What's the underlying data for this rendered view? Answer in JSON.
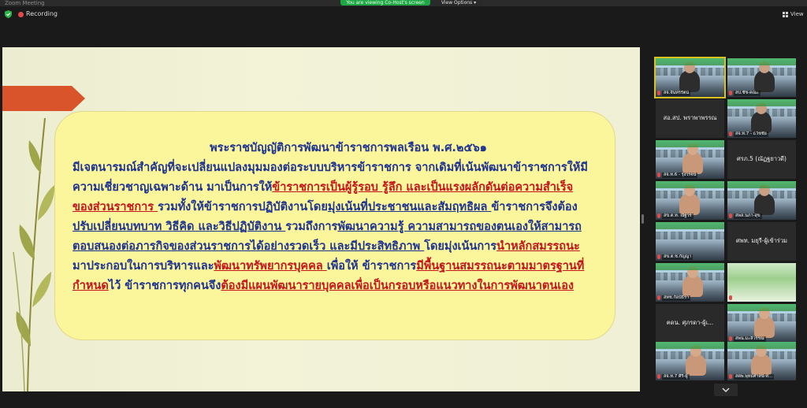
{
  "window": {
    "title": "Zoom Meeting",
    "share_banner": "You are viewing Co-Host's screen",
    "view_options": "View Options ▾"
  },
  "toolbar": {
    "recording_label": "Recording",
    "view_label": "View"
  },
  "slide": {
    "title": "พระราชบัญญัติการพัฒนาข้าราชการพลเรือน พ.ศ.๒๕๖๑",
    "lines": [
      [
        {
          "t": "มีเจตนารมณ์สำคัญที่จะเปลี่ยนแปลงมุมมองต่อระบบบริหารข้าราชการ จากเดิมที่เน้นพัฒนาข้าราชการให้มี",
          "s": "n"
        }
      ],
      [
        {
          "t": "ความเชี่ยวชาญเฉพาะด้าน มาเป็นการให้",
          "s": "n"
        },
        {
          "t": "ข้าราชการเป็นผู้รู้รอบ รู้ลึก และเป็นแรงผลักดันต่อความสำเร็จ",
          "s": "r"
        }
      ],
      [
        {
          "t": "ของส่วนราชการ ",
          "s": "r"
        },
        {
          "t": " รวมทั้งให้ข้าราชการปฏิบัติงานโดย",
          "s": "n"
        },
        {
          "t": "มุ่งเน้นที่ประชาชนและสัมฤทธิผล ",
          "s": "u"
        },
        {
          "t": " ข้าราชการจึงต้อง",
          "s": "n"
        }
      ],
      [
        {
          "t": "ปรับเปลี่ยนบทบาท วิธีคิด และวิธีปฏิบัติงาน ",
          "s": "u"
        },
        {
          "t": " รวมถึงการ",
          "s": "n"
        },
        {
          "t": "พัฒนาความรู้ ความสามารถของตนเองให้สามารถ",
          "s": "u"
        }
      ],
      [
        {
          "t": "ตอบสนองต่อภารกิจของส่วนราชการได้อย่างรวดเร็ว และมีประสิทธิภาพ ",
          "s": "u"
        },
        {
          "t": " โดยมุ่งเน้นการ",
          "s": "n"
        },
        {
          "t": "นำหลักสมรรถนะ",
          "s": "r"
        }
      ],
      [
        {
          "t": "มาประกอบในการบริหารและ",
          "s": "n"
        },
        {
          "t": "พัฒนาทรัพยากรบุคคล ",
          "s": "r"
        },
        {
          "t": " เพื่อให้ ข้าราชการ",
          "s": "n"
        },
        {
          "t": "มีพื้นฐานสมรรถนะตามมาตรฐานที่",
          "s": "r"
        }
      ],
      [
        {
          "t": "กำหนด",
          "s": "r"
        },
        {
          "t": "ไว้ ข้าราชการทุกคนจึง",
          "s": "n"
        },
        {
          "t": "ต้องมีแผนพัฒนารายบุคคลเพื่อเป็นกรอบหรือแนวทางในการพัฒนาตนเอง",
          "s": "r"
        }
      ]
    ]
  },
  "gallery": {
    "tiles": [
      {
        "kind": "video",
        "name": "สจ.จันทรรัตน์",
        "active": true,
        "person": "dark"
      },
      {
        "kind": "video",
        "name": "สป.ชัช-คณะ",
        "active": false,
        "person": "dark"
      },
      {
        "kind": "name",
        "name": "สอ.สป. พราพาพรรณ"
      },
      {
        "kind": "video",
        "name": "สจ.ท.7 - ธวัชชัย",
        "active": false,
        "person": "dark"
      },
      {
        "kind": "video",
        "name": "สจ.ท.6 - รุ่งโรจน์",
        "active": false,
        "person": "light"
      },
      {
        "kind": "name",
        "name": "ศรภ.5 (ณัฏฐยาวดี)"
      },
      {
        "kind": "video",
        "name": "สข.ต.ท. ณัฐวร",
        "active": false,
        "person": "light"
      },
      {
        "kind": "video",
        "name": "สพล.นภา-สุข",
        "active": false,
        "person": "dark"
      },
      {
        "kind": "video",
        "name": "สข.ต.ช.กัญญา",
        "active": false,
        "person": "none"
      },
      {
        "kind": "name",
        "name": "ศพท. มยุรี-ผู้เข้าร่วม"
      },
      {
        "kind": "video",
        "name": "สทช.กัลป์ธิรา",
        "active": false,
        "person": "light"
      },
      {
        "kind": "green",
        "name": "",
        "active": false,
        "person": "none"
      },
      {
        "kind": "name",
        "name": "ฅดน. ศุภรดา-ผู้เ..."
      },
      {
        "kind": "video",
        "name": "สพน.มะลิวรรณ",
        "active": false,
        "person": "light"
      },
      {
        "kind": "video",
        "name": "สจ.ท.7 ศิริ-ผู้",
        "active": false,
        "person": "light"
      },
      {
        "kind": "video",
        "name": "สตพ.พุทธศาสน์-ส...",
        "active": false,
        "person": "light"
      }
    ]
  },
  "colors": {
    "slide_text": "#1f3490",
    "slide_emphasis": "#c4161c",
    "box_fill": "#fbf59b",
    "arrow": "#d9542b",
    "share_banner": "#1ea845"
  }
}
